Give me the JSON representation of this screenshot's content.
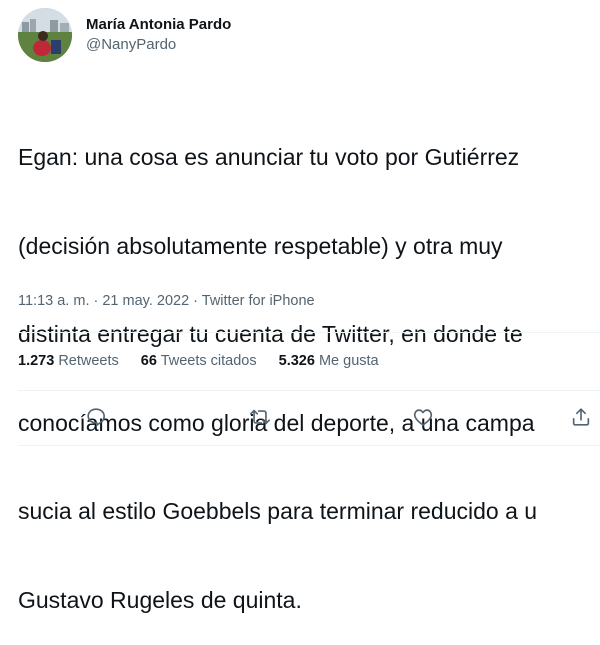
{
  "author": {
    "display_name": "María Antonia Pardo",
    "handle": "@NanyPardo"
  },
  "tweet": {
    "lines": [
      "Egan: una cosa es anunciar tu voto por Gutiérrez",
      "(decisión absolutamente respetable) y otra muy",
      "distinta entregar tu cuenta de Twitter, en donde te",
      "conocíamos como gloria del deporte, a una campa",
      "sucia al estilo Goebbels para terminar reducido a u",
      "Gustavo Rugeles de quinta."
    ],
    "meta": "11:13 a. m. · 21 may. 2022 · Twitter for iPhone"
  },
  "stats": {
    "retweets_count": "1.273",
    "retweets_label": "Retweets",
    "quotes_count": "66",
    "quotes_label": "Tweets citados",
    "likes_count": "5.326",
    "likes_label": "Me gusta"
  },
  "icons": {
    "reply": "reply-icon",
    "retweet": "retweet-icon",
    "like": "like-icon",
    "share": "share-icon"
  },
  "colors": {
    "text": "#0f1419",
    "secondary": "#536471",
    "divider": "#eff3f4"
  }
}
